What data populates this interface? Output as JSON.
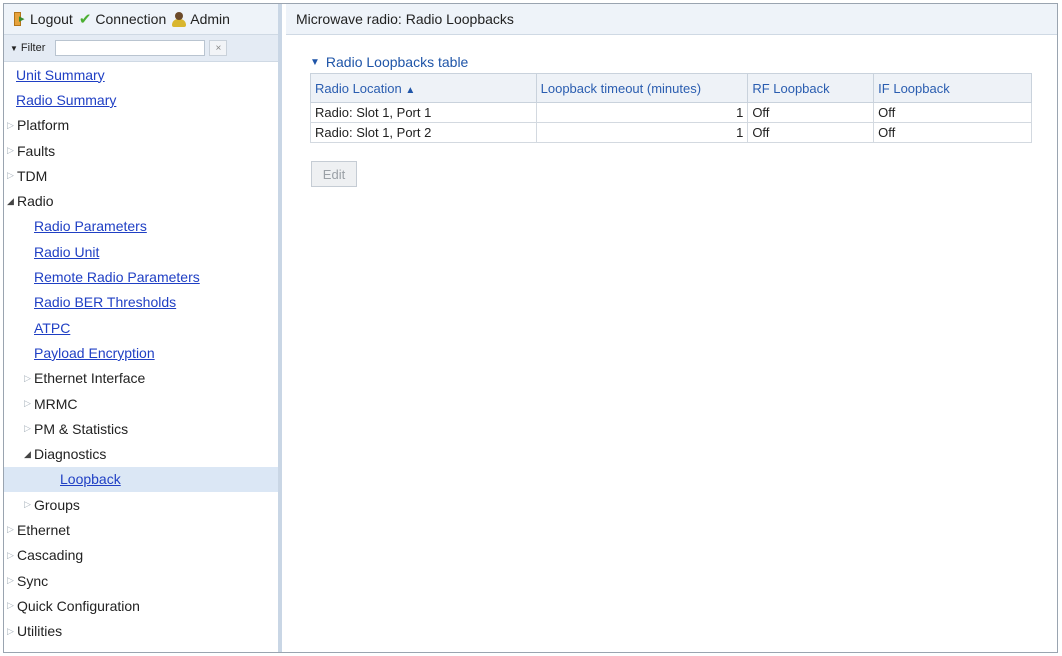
{
  "topbar": {
    "logout_label": "Logout",
    "connection_label": "Connection",
    "admin_label": "Admin"
  },
  "filter": {
    "label": "Filter",
    "value": "",
    "clear_glyph": "×"
  },
  "nav": {
    "unit_summary": "Unit Summary",
    "radio_summary": "Radio Summary",
    "platform": "Platform",
    "faults": "Faults",
    "tdm": "TDM",
    "radio": "Radio",
    "radio_parameters": "Radio Parameters",
    "radio_unit": "Radio Unit",
    "remote_radio_parameters": "Remote Radio Parameters",
    "radio_ber_thresholds": "Radio BER Thresholds",
    "atpc": "ATPC",
    "payload_encryption": "Payload Encryption",
    "ethernet_interface": "Ethernet Interface",
    "mrmc": "MRMC",
    "pm_statistics": "PM & Statistics",
    "diagnostics": "Diagnostics",
    "loopback": "Loopback",
    "groups": "Groups",
    "ethernet": "Ethernet",
    "cascading": "Cascading",
    "sync": "Sync",
    "quick_configuration": "Quick Configuration",
    "utilities": "Utilities"
  },
  "main": {
    "header": "Microwave radio: Radio Loopbacks",
    "section_title": "Radio Loopbacks table",
    "table": {
      "headers": [
        "Radio Location",
        "Loopback timeout (minutes)",
        "RF Loopback",
        "IF Loopback"
      ],
      "rows": [
        [
          "Radio: Slot 1, Port 1",
          "1",
          "Off",
          "Off"
        ],
        [
          "Radio: Slot 1, Port 2",
          "1",
          "Off",
          "Off"
        ]
      ]
    },
    "edit_label": "Edit"
  },
  "icons": {
    "logout": "logout-icon",
    "connection": "check-icon",
    "admin": "admin-user-icon",
    "collapsed": "triangle-right-icon",
    "expanded": "triangle-down-icon",
    "sort": "sort-up-icon"
  },
  "colors": {
    "link": "#1f3fc4",
    "header_text": "#2a5db0",
    "selected_row": "#dbe7f5",
    "panel_bg": "#eef3f9"
  }
}
